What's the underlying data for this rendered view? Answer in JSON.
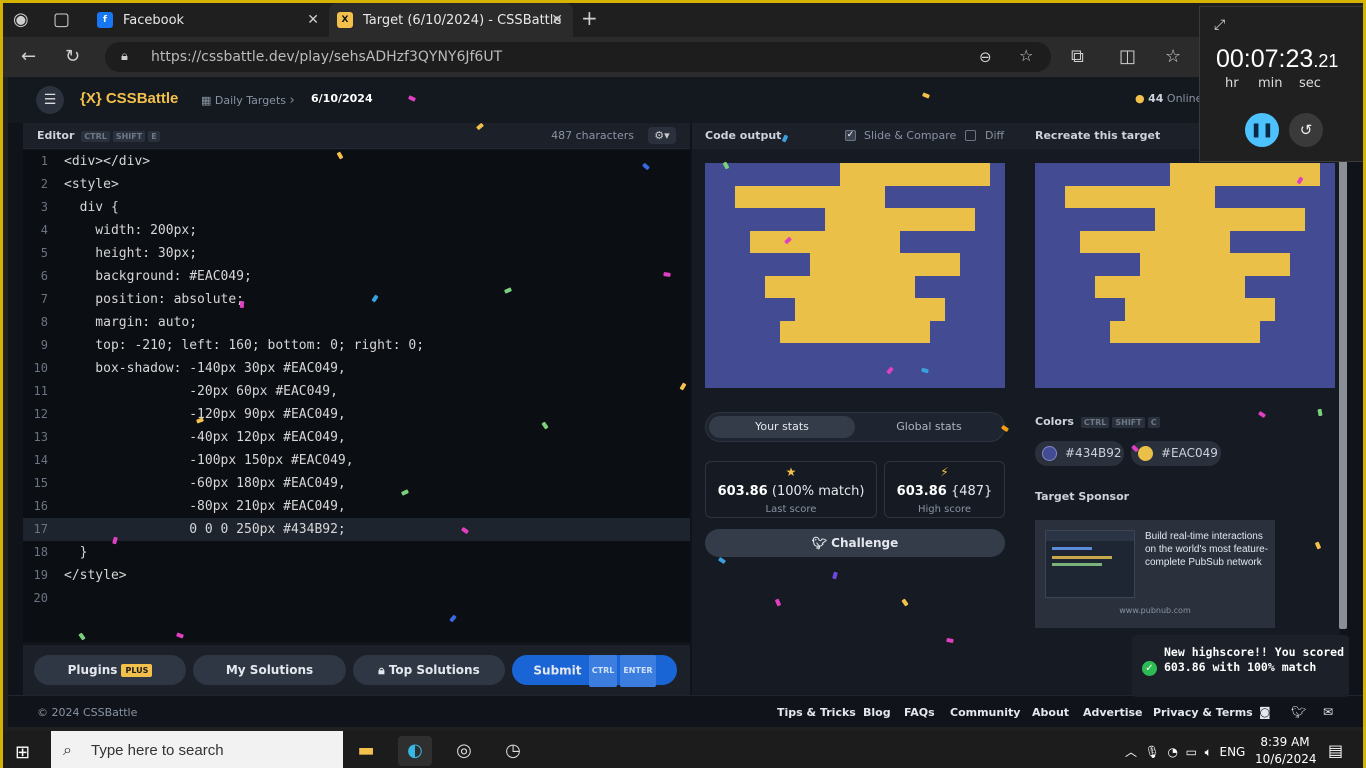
{
  "browser": {
    "tabs": [
      {
        "title": "Facebook"
      },
      {
        "title": "Target (6/10/2024) - CSSBattle"
      }
    ],
    "url": "https://cssbattle.dev/play/sehsADHzf3QYNY6Jf6UT"
  },
  "nav": {
    "logo": "{X} CSSBattle",
    "breadcrumb_section": "Daily Targets",
    "breadcrumb_current": "6/10/2024",
    "online_count": "44",
    "online_label": "Online"
  },
  "editor": {
    "title": "Editor",
    "shortcut": [
      "CTRL",
      "SHIFT",
      "E"
    ],
    "char_count": "487 characters",
    "lines": [
      "<div></div>",
      "<style>",
      "  div {",
      "    width: 200px;",
      "    height: 30px;",
      "    background: #EAC049;",
      "    position: absolute;",
      "    margin: auto;",
      "    top: -210; left: 160; bottom: 0; right: 0;",
      "    box-shadow: -140px 30px #EAC049,",
      "                -20px 60px #EAC049,",
      "                -120px 90px #EAC049,",
      "                -40px 120px #EAC049,",
      "                -100px 150px #EAC049,",
      "                -60px 180px #EAC049,",
      "                -80px 210px #EAC049,",
      "                0 0 0 250px #434B92;",
      "  }",
      "</style>",
      ""
    ],
    "active_line": 17,
    "buttons": {
      "plugins": "Plugins",
      "plugins_badge": "PLUS",
      "my_solutions": "My Solutions",
      "top_solutions": "Top Solutions",
      "submit": "Submit",
      "submit_shortcut": [
        "CTRL",
        "ENTER"
      ]
    }
  },
  "output": {
    "title": "Code output",
    "slide_compare": "Slide & Compare",
    "slide_compare_checked": true,
    "diff": "Diff",
    "diff_checked": false
  },
  "target": {
    "title": "Recreate this target",
    "colors_title": "Colors",
    "colors_shortcut": [
      "CTRL",
      "SHIFT",
      "C"
    ],
    "colors": [
      {
        "hex": "#434B92"
      },
      {
        "hex": "#EAC049"
      }
    ],
    "sponsor_title": "Target Sponsor",
    "sponsor_text": "Build real-time interactions on the world's most feature-complete PubSub network",
    "sponsor_url": "www.pubnub.com"
  },
  "stats": {
    "tab_your": "Your stats",
    "tab_global": "Global stats",
    "last_score": "603.86",
    "last_match": "(100% match)",
    "last_label": "Last score",
    "high_score": "603.86",
    "high_chars": "{487}",
    "high_label": "High score",
    "challenge": "Challenge"
  },
  "footer": {
    "copyright": "© 2024 CSSBattle",
    "links": [
      "Tips & Tricks",
      "Blog",
      "FAQs",
      "Community",
      "About",
      "Advertise",
      "Privacy & Terms"
    ]
  },
  "timer": {
    "time_main": "00:07:23",
    "time_frac": ".21",
    "units": [
      "hr",
      "min",
      "sec"
    ]
  },
  "toast": {
    "text": "New highscore!! You scored 603.86 with 100% match"
  },
  "taskbar": {
    "search_placeholder": "Type here to search",
    "lang": "ENG",
    "time": "8:39 AM",
    "date": "10/6/2024"
  },
  "palette": {
    "bg": "#434B92",
    "fg": "#EAC049",
    "accent": "#f3c04b",
    "submit": "#1a65d6"
  }
}
